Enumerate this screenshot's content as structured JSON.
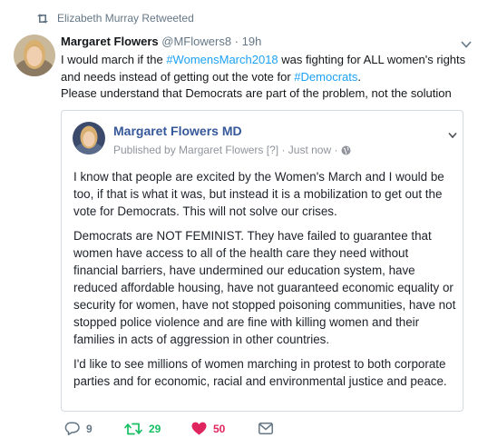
{
  "retweet_bar": {
    "text": "Elizabeth Murray Retweeted"
  },
  "tweet": {
    "author_name": "Margaret Flowers",
    "author_handle": "@MFlowers8",
    "time": "· 19h",
    "text_line1_a": "I would march if the ",
    "hashtag_womensmarch": "#WomensMarch2018",
    "text_line1_b": " was fighting for ALL women's rights and needs instead of getting out the vote for ",
    "hashtag_democrats": "#Democrats",
    "text_line1_c": ".",
    "text_line2": "Please understand that Democrats are part of the problem, not the solution"
  },
  "card": {
    "name": "Margaret Flowers MD",
    "meta_published": "Published by Margaret Flowers",
    "meta_note": "[?]",
    "meta_time": "· Just now ·",
    "para1": "I know that people are excited by the Women's March and I would be too, if that is what it was, but instead it is a mobilization to get out the vote for Democrats. This will not solve our crises.",
    "para2": "Democrats are NOT FEMINIST. They have failed to guarantee that women have access to all of the health care they need without financial barriers, have undermined our education system, have reduced affordable housing, have not guaranteed economic equality or security for women, have not stopped poisoning communities, have not stopped police violence and are fine with killing women and their families in acts of aggression in other countries.",
    "para3": "I'd like to see millions of women marching in protest to both corporate parties and for economic, racial and environmental justice and peace."
  },
  "actions": {
    "reply_count": "9",
    "retweet_count": "29",
    "like_count": "50"
  },
  "colors": {
    "link": "#1da1f2",
    "retweet_green": "#17bf63",
    "like_red": "#e0245e",
    "card_name_blue": "#365899",
    "muted": "#657786"
  },
  "icons": [
    "retweet-icon",
    "chevron-down-icon",
    "globe-icon",
    "reply-icon",
    "like-icon",
    "direct-message-icon"
  ]
}
